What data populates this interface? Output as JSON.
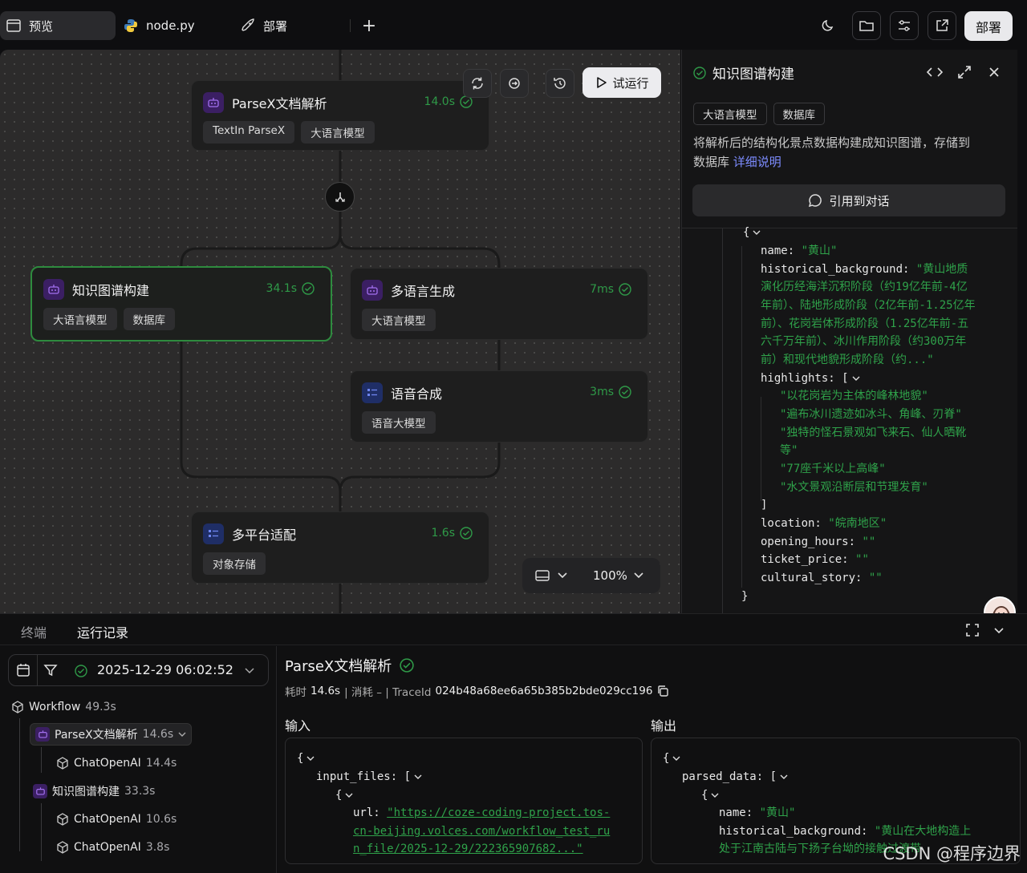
{
  "topbar": {
    "tabs": [
      {
        "label": "预览",
        "icon": "window-icon"
      },
      {
        "label": "node.py",
        "icon": "python-icon"
      },
      {
        "label": "部署",
        "icon": "rocket-icon"
      }
    ],
    "add_tab": "+",
    "deploy_label": "部署"
  },
  "canvas": {
    "run_label": "试运行",
    "zoom": "100%",
    "nodes": [
      {
        "title": "ParseX文档解析",
        "time": "14.0s",
        "tags": [
          "TextIn ParseX",
          "大语言模型"
        ]
      },
      {
        "title": "知识图谱构建",
        "time": "34.1s",
        "tags": [
          "大语言模型",
          "数据库"
        ]
      },
      {
        "title": "多语言生成",
        "time": "7ms",
        "tags": [
          "大语言模型"
        ]
      },
      {
        "title": "语音合成",
        "time": "3ms",
        "tags": [
          "语音大模型"
        ]
      },
      {
        "title": "多平台适配",
        "time": "1.6s",
        "tags": [
          "对象存储"
        ]
      }
    ]
  },
  "panel": {
    "title": "知识图谱构建",
    "tags": [
      "大语言模型",
      "数据库"
    ],
    "desc_line1": "将解析后的结构化景点数据构建成知识图谱，存储到",
    "desc_line2": "数据库",
    "desc_link": "详细说明",
    "quote_label": "引用到对话",
    "json": {
      "brace_open": "{",
      "name_key": "name:",
      "name_val": "\"黄山\"",
      "hb_key": "historical_background:",
      "hb_val_1": "\"黄山地质",
      "hb_val_2": "演化历经海洋沉积阶段（约19亿年前-4亿",
      "hb_val_3": "年前）、陆地形成阶段（2亿年前-1.25亿年",
      "hb_val_4": "前）、花岗岩体形成阶段（1.25亿年前-五",
      "hb_val_5": "六千万年前）、冰川作用阶段（约300万年",
      "hb_val_6": "前）和现代地貌形成阶段（约...\"",
      "hl_key": "highlights: [",
      "highlights": [
        "\"以花岗岩为主体的峰林地貌\"",
        "\"遍布冰川遗迹如冰斗、角峰、刃脊\"",
        "\"独特的怪石景观如飞来石、仙人晒靴",
        "等\"",
        "\"77座千米以上高峰\"",
        "\"水文景观沿断层和节理发育\""
      ],
      "hl_close": "]",
      "loc_key": "location:",
      "loc_val": "\"皖南地区\"",
      "oh_key": "opening_hours:",
      "oh_val": "\"\"",
      "tp_key": "ticket_price:",
      "tp_val": "\"\"",
      "cs_key": "cultural_story:",
      "cs_val": "\"\"",
      "brace_close": "}"
    }
  },
  "bottom": {
    "tabs": [
      "终端",
      "运行记录"
    ],
    "datetime": "2025-12-29 06:02:52",
    "tree": [
      {
        "label": "Workflow",
        "dur": "49.3s"
      },
      {
        "label": "ParseX文档解析",
        "dur": "14.6s"
      },
      {
        "label": "ChatOpenAI",
        "dur": "14.4s"
      },
      {
        "label": "知识图谱构建",
        "dur": "33.3s"
      },
      {
        "label": "ChatOpenAI",
        "dur": "10.6s"
      },
      {
        "label": "ChatOpenAI",
        "dur": "3.8s"
      }
    ],
    "detail": {
      "title": "ParseX文档解析",
      "meta_prefix": "耗时",
      "meta_time": "14.6s",
      "meta_cost_label": "| 消耗 – | TraceId",
      "trace_id": "024b48a68ee6a65b385b2bde029cc196",
      "input_label": "输入",
      "output_label": "输出",
      "input": {
        "brace": "{",
        "if_key": "input_files: [",
        "inner_brace": "{",
        "url_key": "url:",
        "url_1": "\"https://coze-coding-project.tos-",
        "url_2": "cn-beijing.volces.com/workflow_test_ru",
        "url_3": "n_file/2025-12-29/222365907682...\""
      },
      "output": {
        "brace": "{",
        "pd_key": "parsed_data: [",
        "inner_brace": "{",
        "name_key": "name:",
        "name_val": "\"黄山\"",
        "hb_key": "historical_background:",
        "hb_val": "\"黄山在大地构造上",
        "hb_val_2": "处于江南古陆与下扬子台坳的接触过渡带"
      }
    }
  },
  "watermark": "CSDN @程序边界",
  "colors": {
    "accent_green": "#2fa24a",
    "link_blue": "#7d8cff",
    "node_purple": "#3b1f63"
  }
}
